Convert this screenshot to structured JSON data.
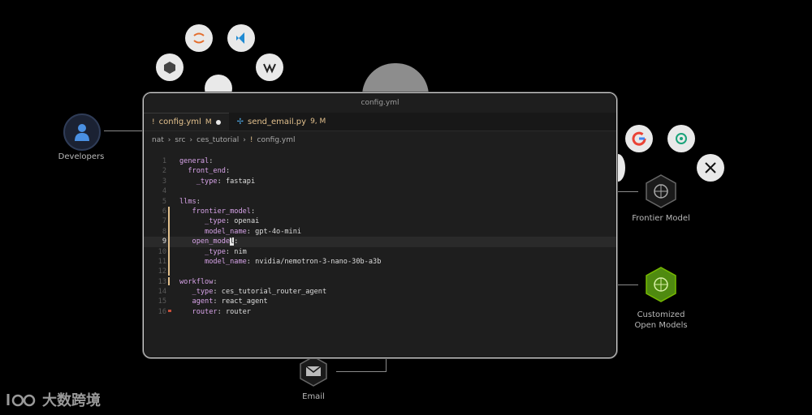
{
  "background": {
    "developers_label": "Developers",
    "frontier_label": "Frontier Model",
    "custom_label_line1": "Customized",
    "custom_label_line2": "Open Models",
    "email_label": "Email",
    "watermark_text": "大数跨境",
    "accent": "#76b900"
  },
  "window": {
    "title": "config.yml"
  },
  "tabs": [
    {
      "icon": "!",
      "label": "config.yml",
      "badge": "M",
      "active": true
    },
    {
      "icon": "✢",
      "label": "send_email.py",
      "badge": "9, M",
      "active": false
    }
  ],
  "breadcrumb": {
    "parts": [
      "nat",
      "src",
      "ces_tutorial"
    ],
    "file_icon": "!",
    "file": "config.yml"
  },
  "code": {
    "current_line": 9,
    "lines": [
      {
        "n": "1",
        "key": "general",
        "indent": "",
        "value": ""
      },
      {
        "n": "2",
        "key": "front_end",
        "indent": "  ",
        "value": ""
      },
      {
        "n": "3",
        "key": "_type",
        "indent": "    ",
        "value": " fastapi"
      },
      {
        "n": "4",
        "key": "",
        "indent": "",
        "value": ""
      },
      {
        "n": "5",
        "key": "llms",
        "indent": "",
        "value": ""
      },
      {
        "n": "6",
        "key": "frontier_model",
        "indent": "   ",
        "value": ""
      },
      {
        "n": "7",
        "key": "_type",
        "indent": "      ",
        "value": " openai"
      },
      {
        "n": "8",
        "key": "model_name",
        "indent": "      ",
        "value": " gpt-4o-mini"
      },
      {
        "n": "9",
        "key": "open_model",
        "indent": "   ",
        "value": ""
      },
      {
        "n": "10",
        "key": "_type",
        "indent": "      ",
        "value": " nim"
      },
      {
        "n": "11",
        "key": "model_name",
        "indent": "      ",
        "value": " nvidia/nemotron-3-nano-30b-a3b"
      },
      {
        "n": "12",
        "key": "",
        "indent": "",
        "value": ""
      },
      {
        "n": "13",
        "key": "workflow",
        "indent": "",
        "value": ""
      },
      {
        "n": "14",
        "key": "_type",
        "indent": "   ",
        "value": " ces_tutorial_router_agent"
      },
      {
        "n": "15",
        "key": "agent",
        "indent": "   ",
        "value": " react_agent"
      },
      {
        "n": "16",
        "key": "router",
        "indent": "   ",
        "value": " router"
      }
    ]
  }
}
